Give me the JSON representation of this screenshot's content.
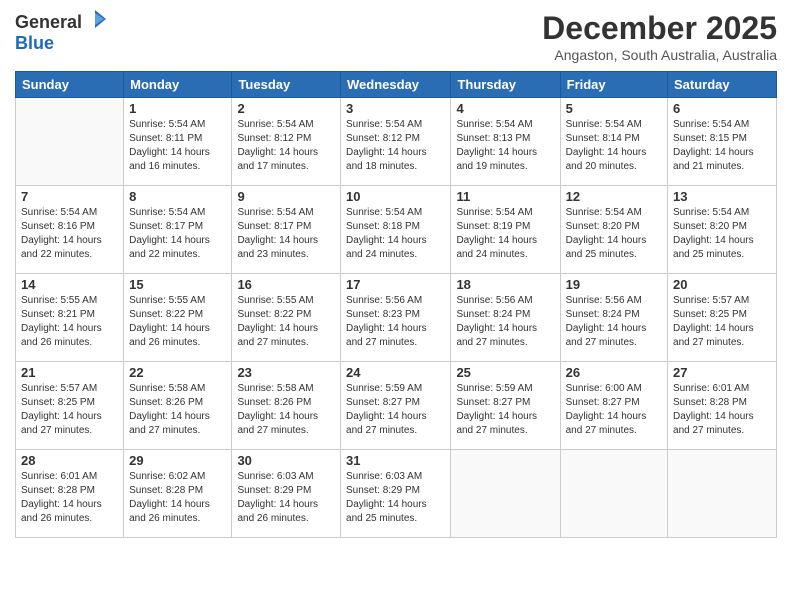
{
  "logo": {
    "general": "General",
    "blue": "Blue"
  },
  "header": {
    "month": "December 2025",
    "location": "Angaston, South Australia, Australia"
  },
  "weekdays": [
    "Sunday",
    "Monday",
    "Tuesday",
    "Wednesday",
    "Thursday",
    "Friday",
    "Saturday"
  ],
  "weeks": [
    [
      {
        "day": "",
        "info": ""
      },
      {
        "day": "1",
        "info": "Sunrise: 5:54 AM\nSunset: 8:11 PM\nDaylight: 14 hours\nand 16 minutes."
      },
      {
        "day": "2",
        "info": "Sunrise: 5:54 AM\nSunset: 8:12 PM\nDaylight: 14 hours\nand 17 minutes."
      },
      {
        "day": "3",
        "info": "Sunrise: 5:54 AM\nSunset: 8:12 PM\nDaylight: 14 hours\nand 18 minutes."
      },
      {
        "day": "4",
        "info": "Sunrise: 5:54 AM\nSunset: 8:13 PM\nDaylight: 14 hours\nand 19 minutes."
      },
      {
        "day": "5",
        "info": "Sunrise: 5:54 AM\nSunset: 8:14 PM\nDaylight: 14 hours\nand 20 minutes."
      },
      {
        "day": "6",
        "info": "Sunrise: 5:54 AM\nSunset: 8:15 PM\nDaylight: 14 hours\nand 21 minutes."
      }
    ],
    [
      {
        "day": "7",
        "info": "Sunrise: 5:54 AM\nSunset: 8:16 PM\nDaylight: 14 hours\nand 22 minutes."
      },
      {
        "day": "8",
        "info": "Sunrise: 5:54 AM\nSunset: 8:17 PM\nDaylight: 14 hours\nand 22 minutes."
      },
      {
        "day": "9",
        "info": "Sunrise: 5:54 AM\nSunset: 8:17 PM\nDaylight: 14 hours\nand 23 minutes."
      },
      {
        "day": "10",
        "info": "Sunrise: 5:54 AM\nSunset: 8:18 PM\nDaylight: 14 hours\nand 24 minutes."
      },
      {
        "day": "11",
        "info": "Sunrise: 5:54 AM\nSunset: 8:19 PM\nDaylight: 14 hours\nand 24 minutes."
      },
      {
        "day": "12",
        "info": "Sunrise: 5:54 AM\nSunset: 8:20 PM\nDaylight: 14 hours\nand 25 minutes."
      },
      {
        "day": "13",
        "info": "Sunrise: 5:54 AM\nSunset: 8:20 PM\nDaylight: 14 hours\nand 25 minutes."
      }
    ],
    [
      {
        "day": "14",
        "info": "Sunrise: 5:55 AM\nSunset: 8:21 PM\nDaylight: 14 hours\nand 26 minutes."
      },
      {
        "day": "15",
        "info": "Sunrise: 5:55 AM\nSunset: 8:22 PM\nDaylight: 14 hours\nand 26 minutes."
      },
      {
        "day": "16",
        "info": "Sunrise: 5:55 AM\nSunset: 8:22 PM\nDaylight: 14 hours\nand 27 minutes."
      },
      {
        "day": "17",
        "info": "Sunrise: 5:56 AM\nSunset: 8:23 PM\nDaylight: 14 hours\nand 27 minutes."
      },
      {
        "day": "18",
        "info": "Sunrise: 5:56 AM\nSunset: 8:24 PM\nDaylight: 14 hours\nand 27 minutes."
      },
      {
        "day": "19",
        "info": "Sunrise: 5:56 AM\nSunset: 8:24 PM\nDaylight: 14 hours\nand 27 minutes."
      },
      {
        "day": "20",
        "info": "Sunrise: 5:57 AM\nSunset: 8:25 PM\nDaylight: 14 hours\nand 27 minutes."
      }
    ],
    [
      {
        "day": "21",
        "info": "Sunrise: 5:57 AM\nSunset: 8:25 PM\nDaylight: 14 hours\nand 27 minutes."
      },
      {
        "day": "22",
        "info": "Sunrise: 5:58 AM\nSunset: 8:26 PM\nDaylight: 14 hours\nand 27 minutes."
      },
      {
        "day": "23",
        "info": "Sunrise: 5:58 AM\nSunset: 8:26 PM\nDaylight: 14 hours\nand 27 minutes."
      },
      {
        "day": "24",
        "info": "Sunrise: 5:59 AM\nSunset: 8:27 PM\nDaylight: 14 hours\nand 27 minutes."
      },
      {
        "day": "25",
        "info": "Sunrise: 5:59 AM\nSunset: 8:27 PM\nDaylight: 14 hours\nand 27 minutes."
      },
      {
        "day": "26",
        "info": "Sunrise: 6:00 AM\nSunset: 8:27 PM\nDaylight: 14 hours\nand 27 minutes."
      },
      {
        "day": "27",
        "info": "Sunrise: 6:01 AM\nSunset: 8:28 PM\nDaylight: 14 hours\nand 27 minutes."
      }
    ],
    [
      {
        "day": "28",
        "info": "Sunrise: 6:01 AM\nSunset: 8:28 PM\nDaylight: 14 hours\nand 26 minutes."
      },
      {
        "day": "29",
        "info": "Sunrise: 6:02 AM\nSunset: 8:28 PM\nDaylight: 14 hours\nand 26 minutes."
      },
      {
        "day": "30",
        "info": "Sunrise: 6:03 AM\nSunset: 8:29 PM\nDaylight: 14 hours\nand 26 minutes."
      },
      {
        "day": "31",
        "info": "Sunrise: 6:03 AM\nSunset: 8:29 PM\nDaylight: 14 hours\nand 25 minutes."
      },
      {
        "day": "",
        "info": ""
      },
      {
        "day": "",
        "info": ""
      },
      {
        "day": "",
        "info": ""
      }
    ]
  ]
}
